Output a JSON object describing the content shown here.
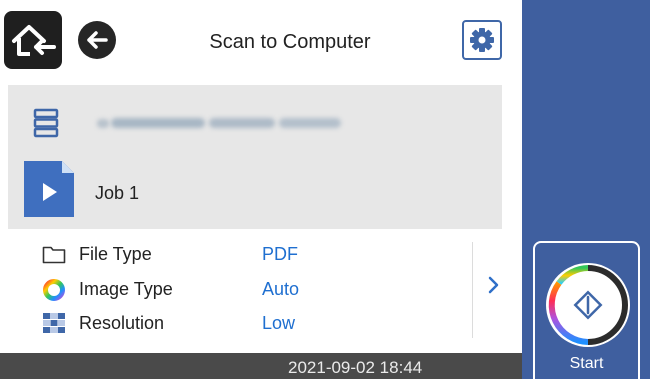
{
  "header": {
    "title": "Scan to Computer",
    "home_icon": "home-icon",
    "back_icon": "back-arrow-icon",
    "settings_icon": "gear-icon"
  },
  "destination": {
    "server_icon": "server-icon"
  },
  "job": {
    "label": "Job 1",
    "icon": "job-document-icon"
  },
  "settings": [
    {
      "label": "File Type",
      "value": "PDF",
      "icon": "folder-icon"
    },
    {
      "label": "Image Type",
      "value": "Auto",
      "icon": "color-ring-icon"
    },
    {
      "label": "Resolution",
      "value": "Low",
      "icon": "resolution-icon"
    }
  ],
  "status_bar": {
    "timestamp": "2021-09-02 18:44"
  },
  "start": {
    "label": "Start",
    "icon": "start-icon"
  },
  "colors": {
    "accent_blue": "#3f5f9f",
    "value_blue": "#1f6fd0",
    "panel_gray": "#e7e7e7",
    "status_bar": "#4a4a4a"
  }
}
